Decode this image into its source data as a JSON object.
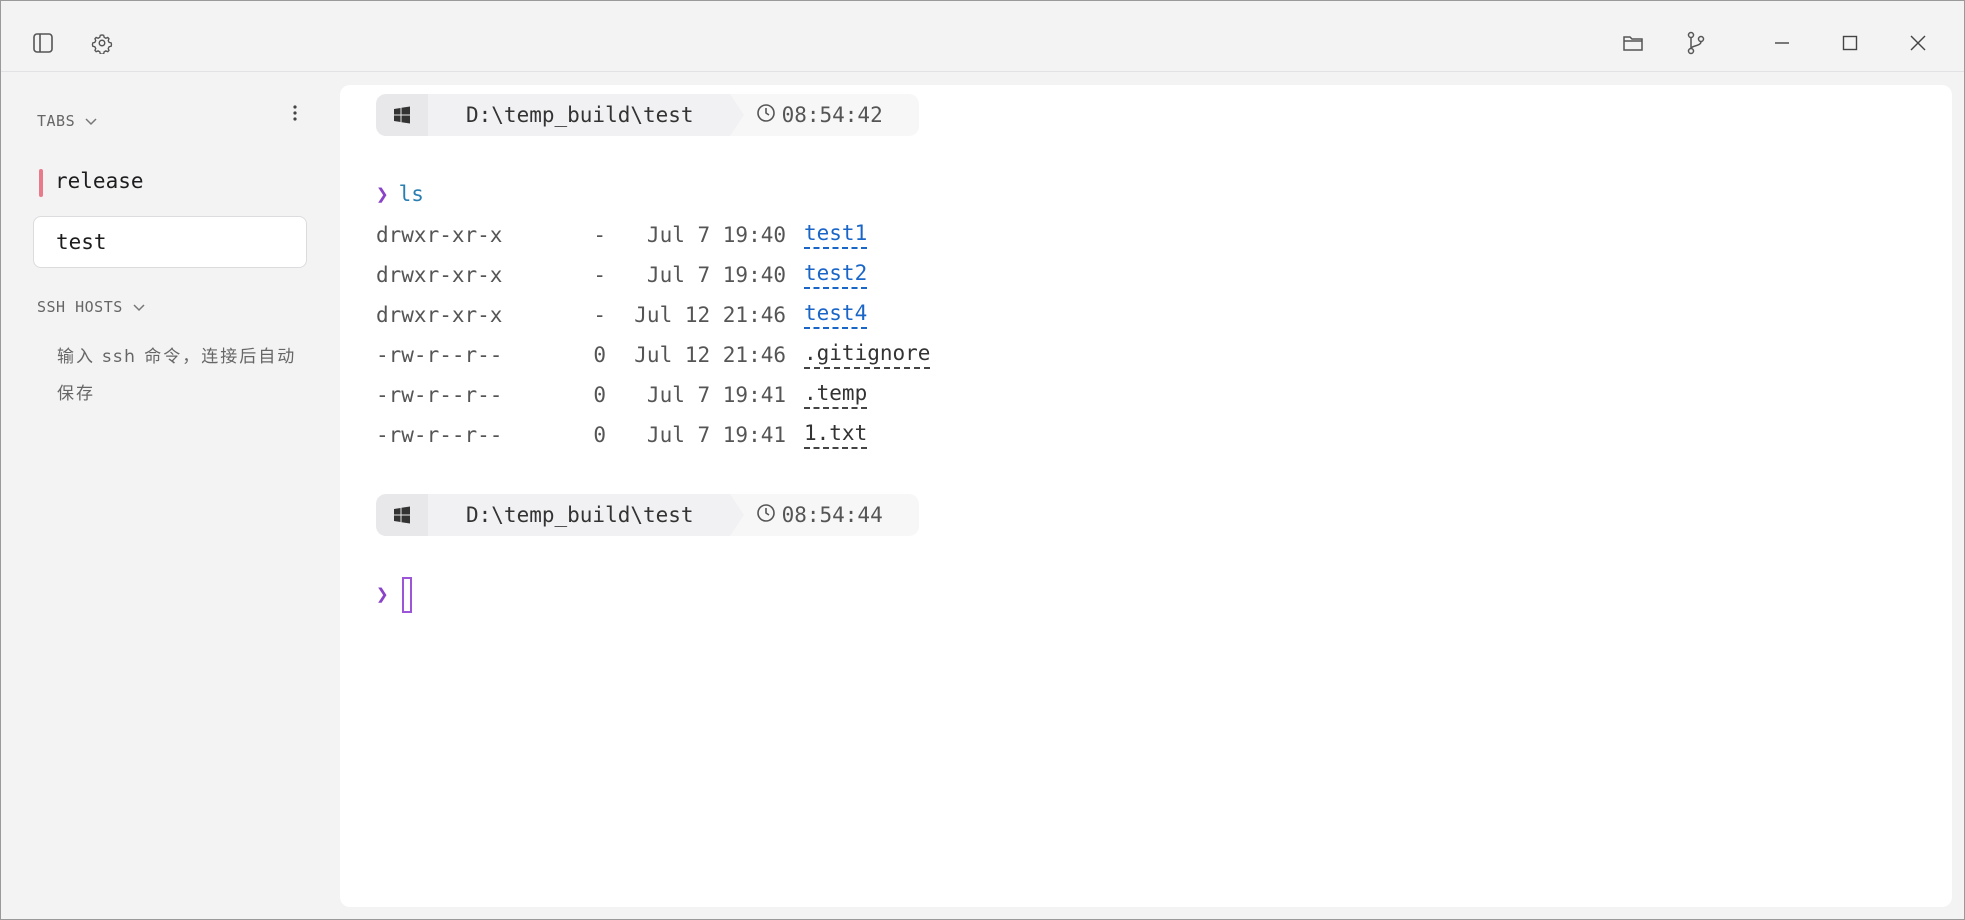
{
  "sidebar": {
    "tabs_header": "TABS",
    "tabs": [
      {
        "label": "release"
      },
      {
        "label": "test"
      }
    ],
    "ssh_header": "SSH HOSTS",
    "ssh_hint": "输入 ssh 命令，连接后自动保存"
  },
  "terminal": {
    "blocks": [
      {
        "path": "D:\\temp_build\\test",
        "time": "08:54:42"
      },
      {
        "path": "D:\\temp_build\\test",
        "time": "08:54:44"
      }
    ],
    "prompt_symbol": "❯",
    "command": "ls",
    "ls_rows": [
      {
        "perm": "drwxr-xr-x",
        "size": "-",
        "date": "Jul 7 19:40",
        "name": "test1"
      },
      {
        "perm": "drwxr-xr-x",
        "size": "-",
        "date": "Jul 7 19:40",
        "name": "test2"
      },
      {
        "perm": "drwxr-xr-x",
        "size": "-",
        "date": "Jul 12 21:46",
        "name": "test4"
      },
      {
        "perm": "-rw-r--r--",
        "size": "0",
        "date": "Jul 12 21:46",
        "name": ".gitignore"
      },
      {
        "perm": "-rw-r--r--",
        "size": "0",
        "date": "Jul 7 19:41",
        "name": ".temp"
      },
      {
        "perm": "-rw-r--r--",
        "size": "0",
        "date": "Jul 7 19:41",
        "name": "1.txt"
      }
    ]
  },
  "colors": {
    "accent_prompt": "#8a44c8",
    "dir_link": "#1a66c8",
    "active_tab_marker": "#e87a8a"
  }
}
